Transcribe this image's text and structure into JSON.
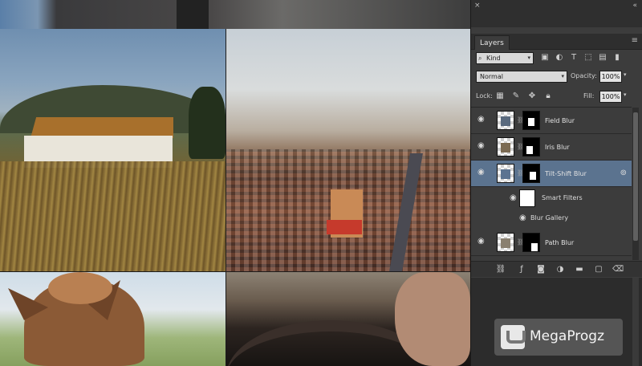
{
  "panel": {
    "collapse_glyph": "×",
    "expand_glyph": "«",
    "tab_label": "Layers",
    "menu_glyph": "≡",
    "filter": {
      "kind_label": "Kind",
      "icons": [
        "image-filter-icon",
        "adjustment-filter-icon",
        "type-filter-icon",
        "shape-filter-icon",
        "smart-object-filter-icon",
        "filter-toggle-icon"
      ]
    },
    "blend_mode": "Normal",
    "opacity_label": "Opacity:",
    "opacity_value": "100%",
    "lock_label": "Lock:",
    "fill_label": "Fill:",
    "fill_value": "100%",
    "layers": [
      {
        "name": "Field Blur",
        "selected": false
      },
      {
        "name": "Iris Blur",
        "selected": false
      },
      {
        "name": "Tilt-Shift Blur",
        "selected": true
      },
      {
        "name": "Path Blur",
        "selected": false
      }
    ],
    "smart_filters_label": "Smart Filters",
    "blur_gallery_label": "Blur Gallery"
  },
  "watermark": {
    "text": "MegaProgz"
  },
  "colors": {
    "panel_bg": "#3c3c3c",
    "selected_layer": "#5b738f",
    "canvas_bg": "#1e1e1e"
  }
}
